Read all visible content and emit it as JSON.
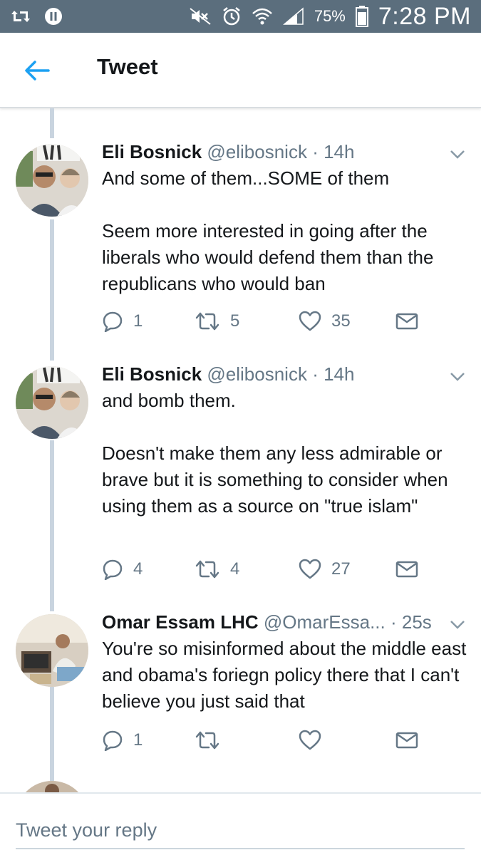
{
  "status_bar": {
    "battery_percent": "75%",
    "time": "7:28 PM",
    "icons": [
      "retweet-notification-icon",
      "pause-icon",
      "mute-icon",
      "alarm-icon",
      "wifi-icon",
      "signal-icon",
      "battery-icon"
    ]
  },
  "app_bar": {
    "title": "Tweet",
    "back_icon": "arrow-left-icon"
  },
  "colors": {
    "status_bar_bg": "#5b6e7d",
    "accent": "#1da1f2",
    "thread_line": "#c9d4df",
    "secondary_text": "#657786"
  },
  "tweets": [
    {
      "name": "Eli Bosnick",
      "handle": "@elibosnick",
      "time": "· 14h",
      "text": "And some of them...SOME of them\n\nSeem more interested in going after the liberals who would defend them than the republicans who would ban",
      "replies": "1",
      "retweets": "5",
      "likes": "35"
    },
    {
      "name": "Eli Bosnick",
      "handle": "@elibosnick",
      "time": "· 14h",
      "text": "and bomb them.\n\nDoesn't make them any less admirable or brave but it is something to consider when using them as a source on \"true islam\"",
      "replies": "4",
      "retweets": "4",
      "likes": "27"
    },
    {
      "name": "Omar Essam LHC",
      "handle": "@OmarEssa...",
      "time": "· 25s",
      "text": "You're so misinformed about the middle east and obama's foriegn policy there that I can't believe you just said that",
      "replies": "1",
      "retweets": "",
      "likes": ""
    }
  ],
  "reply": {
    "placeholder": "Tweet your reply"
  }
}
